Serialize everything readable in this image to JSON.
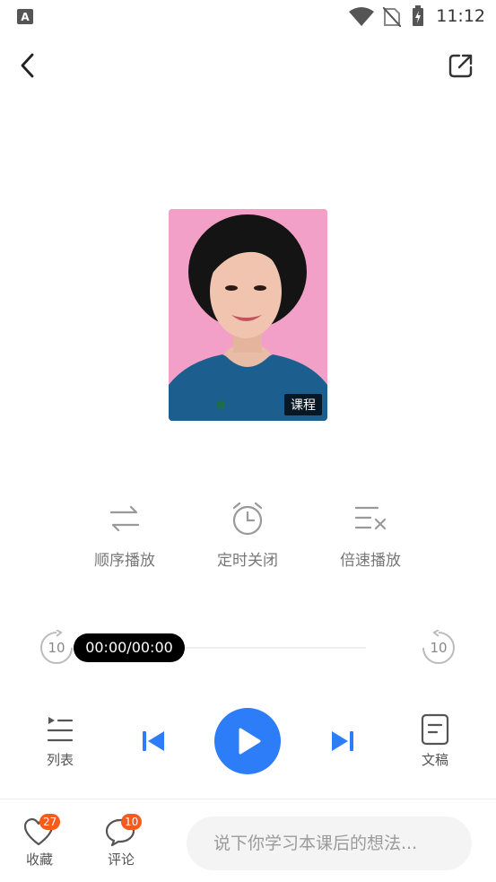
{
  "status_bar": {
    "time": "11:12"
  },
  "cover": {
    "badge": "课程"
  },
  "controls": [
    {
      "label": "顺序播放",
      "icon": "sequential-play-icon"
    },
    {
      "label": "定时关闭",
      "icon": "alarm-clock-icon"
    },
    {
      "label": "倍速播放",
      "icon": "playback-speed-icon"
    }
  ],
  "player": {
    "time": "00:00/00:00",
    "rewind_seconds": "10",
    "forward_seconds": "10",
    "progress": 0
  },
  "bottom_controls": {
    "list_label": "列表",
    "transcript_label": "文稿"
  },
  "footer": {
    "favorite_label": "收藏",
    "favorite_count": "27",
    "comment_label": "评论",
    "comment_count": "10",
    "comment_placeholder": "说下你学习本课后的想法..."
  },
  "colors": {
    "accent": "#2c7df7",
    "badge": "#f55a1e",
    "cover_bg": "#f2a0c8"
  }
}
